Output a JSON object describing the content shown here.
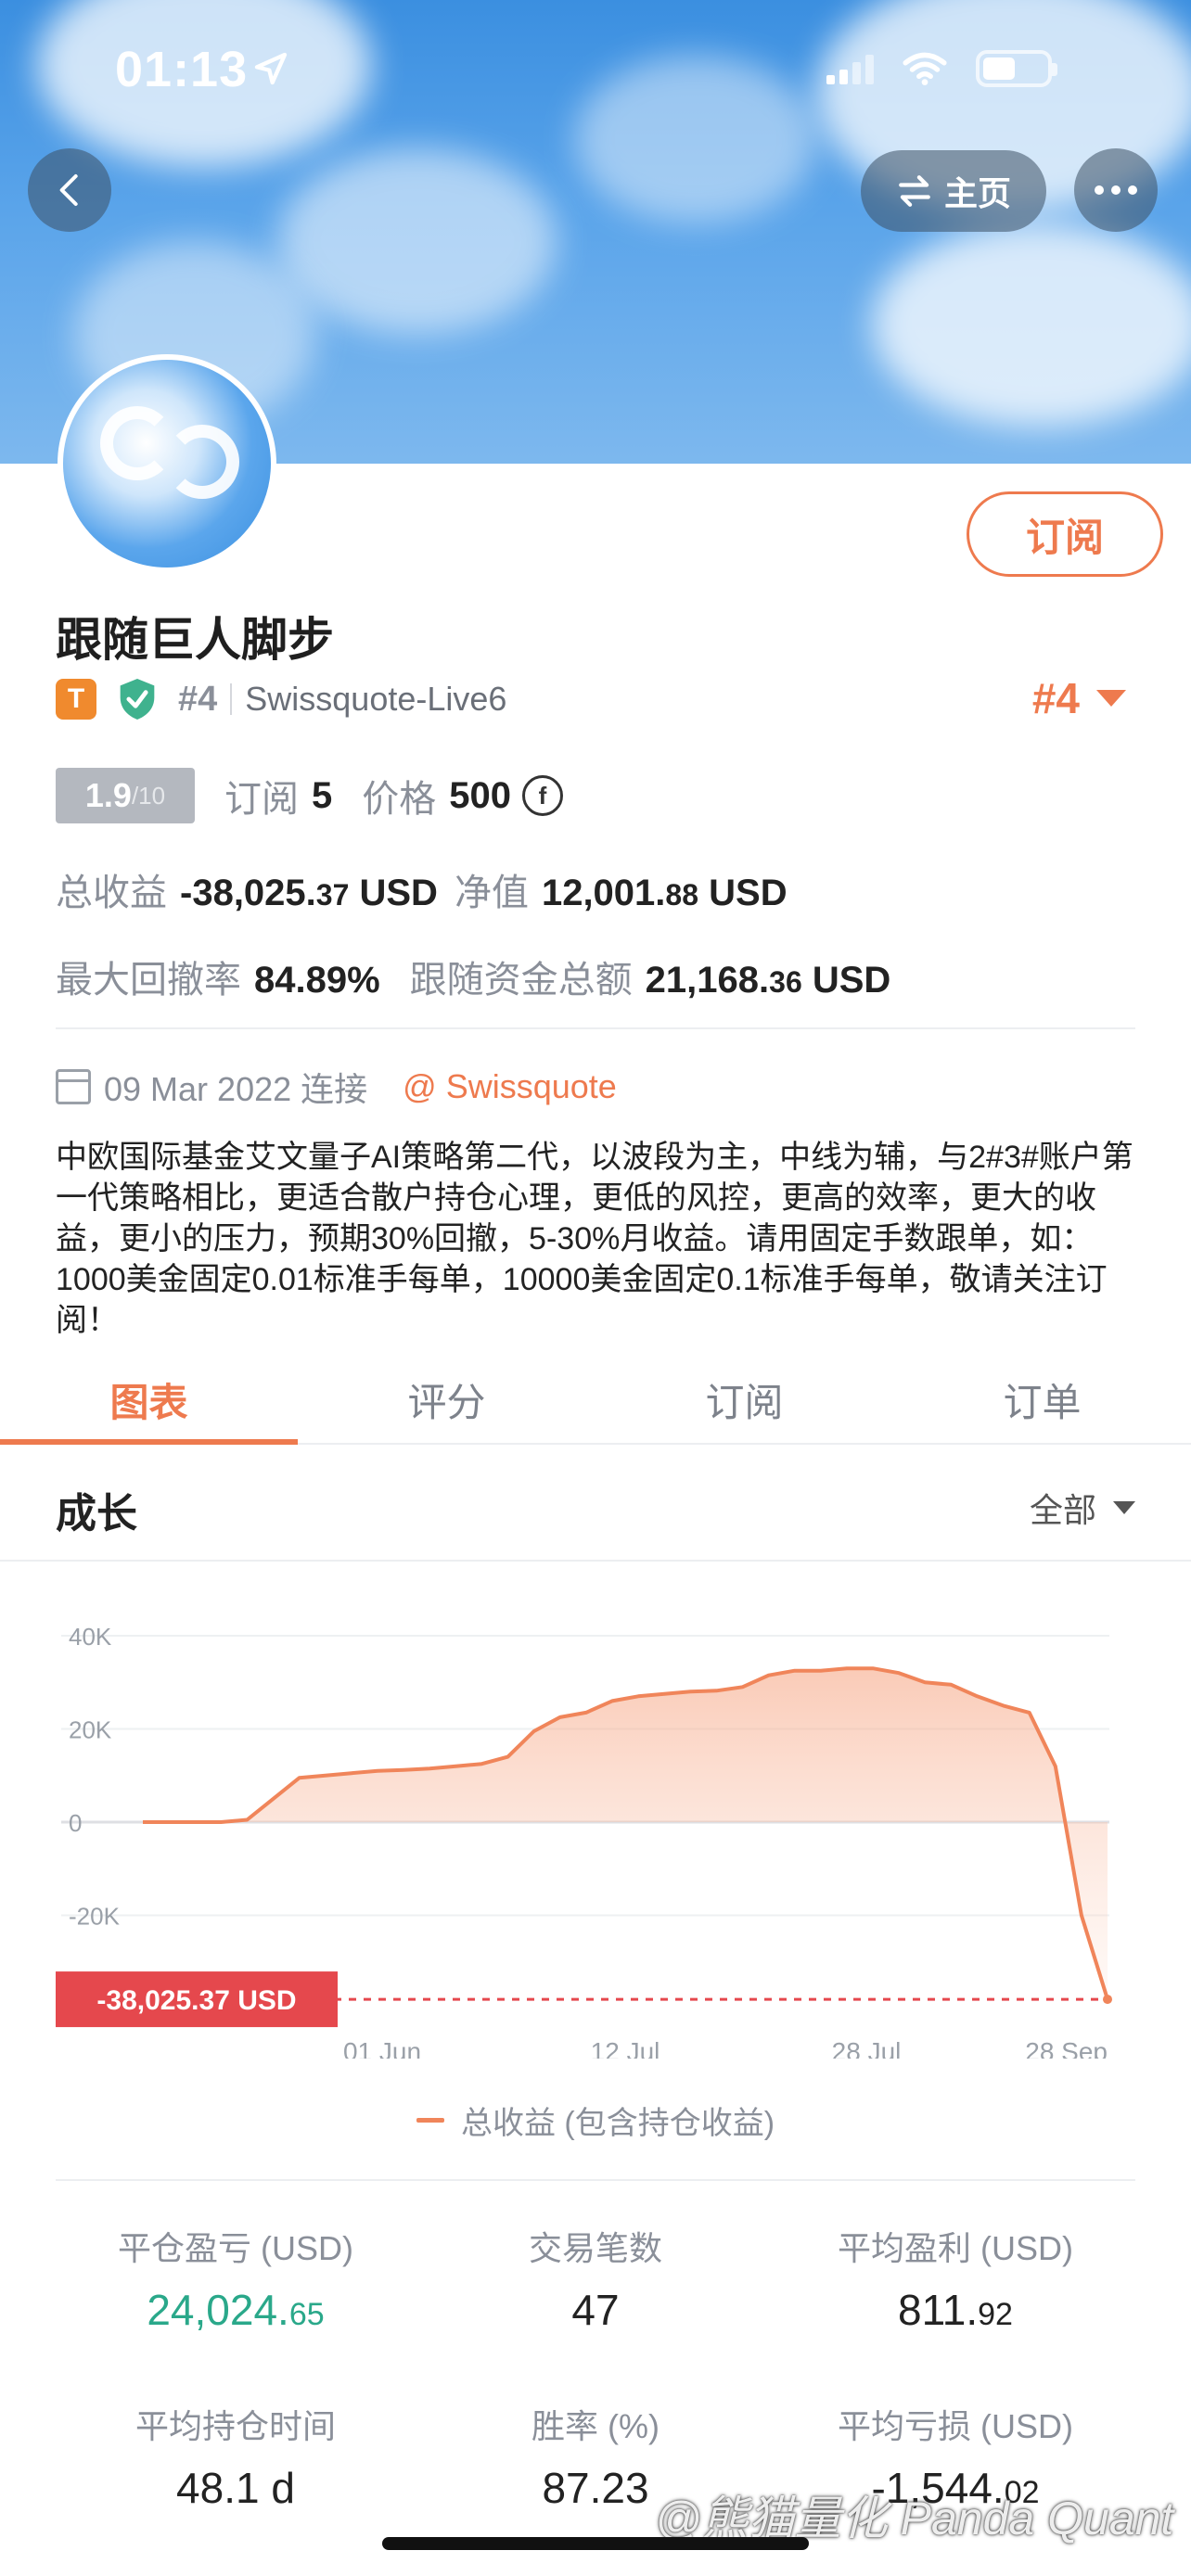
{
  "status_bar": {
    "time": "01:13"
  },
  "header": {
    "home_label": "主页"
  },
  "profile": {
    "subscribe_label": "订阅",
    "name": "跟随巨人脚步",
    "badge_letter": "T",
    "rank_tag": "#4",
    "broker": "Swissquote-Live6",
    "rank_right": "#4"
  },
  "stats": {
    "score_main": "1.9",
    "score_total": "/10",
    "subscribe_label": "订阅",
    "subscribe_count": "5",
    "price_label": "价格",
    "price_value": "500",
    "total_profit_label": "总收益",
    "total_profit_int": "-38,025.",
    "total_profit_dec": "37",
    "total_profit_unit": " USD",
    "equity_label": "净值",
    "equity_int": "12,001.",
    "equity_dec": "88",
    "equity_unit": " USD",
    "max_dd_label": "最大回撤率",
    "max_dd_value": "84.89%",
    "follow_funds_label": "跟随资金总额",
    "follow_funds_int": "21,168.",
    "follow_funds_dec": "36",
    "follow_funds_unit": " USD"
  },
  "connection": {
    "date_text": "09 Mar 2022 连接",
    "link_text": "@ Swissquote"
  },
  "description": "中欧国际基金艾文量子AI策略第二代，以波段为主，中线为辅，与2#3#账户第一代策略相比，更适合散户持仓心理，更低的风控，更高的效率，更大的收益，更小的压力，预期30%回撤，5-30%月收益。请用固定手数跟单，如：1000美金固定0.01标准手每单，10000美金固定0.1标准手每单，敬请关注订阅！",
  "tabs": [
    {
      "label": "图表",
      "active": true
    },
    {
      "label": "评分",
      "active": false
    },
    {
      "label": "订阅",
      "active": false
    },
    {
      "label": "订单",
      "active": false
    }
  ],
  "growth": {
    "title": "成长",
    "filter_label": "全部"
  },
  "chart_data": {
    "type": "area",
    "y_ticks": [
      "40K",
      "20K",
      "0",
      "-20K"
    ],
    "x_ticks": [
      "01 Jun",
      "12 Jul",
      "28 Jul",
      "28 Sep"
    ],
    "ylim": [
      -40000,
      40000
    ],
    "current_value_label": "-38,025.37 USD",
    "current_value": -38025.37,
    "legend": "总收益 (包含持仓收益)",
    "color": "#f0855a",
    "series": [
      {
        "name": "总收益 (包含持仓收益)",
        "values": [
          0,
          0,
          0,
          0,
          500,
          5000,
          9500,
          10000,
          10500,
          11000,
          11200,
          11500,
          12000,
          12500,
          14000,
          19500,
          22500,
          23500,
          26000,
          27000,
          27500,
          28000,
          28200,
          29000,
          31500,
          32500,
          32500,
          33000,
          33000,
          32000,
          30000,
          29500,
          27000,
          25000,
          23500,
          12000,
          -20000,
          -38025.37
        ]
      }
    ]
  },
  "kpis": [
    {
      "label": "平仓盈亏 (USD)",
      "int": "24,024.",
      "dec": "65",
      "color": "green"
    },
    {
      "label": "交易笔数",
      "int": "47",
      "dec": "",
      "color": "default"
    },
    {
      "label": "平均盈利 (USD)",
      "int": "811.",
      "dec": "92",
      "color": "default"
    },
    {
      "label": "平均持仓时间",
      "int": "48.1 d",
      "dec": "",
      "color": "default"
    },
    {
      "label": "胜率 (%)",
      "int": "87.23",
      "dec": "",
      "color": "default"
    },
    {
      "label": "平均亏损 (USD)",
      "int": "-1,544.",
      "dec": "02",
      "color": "default"
    }
  ],
  "watermark": "@熊猫量化 Panda Quant"
}
